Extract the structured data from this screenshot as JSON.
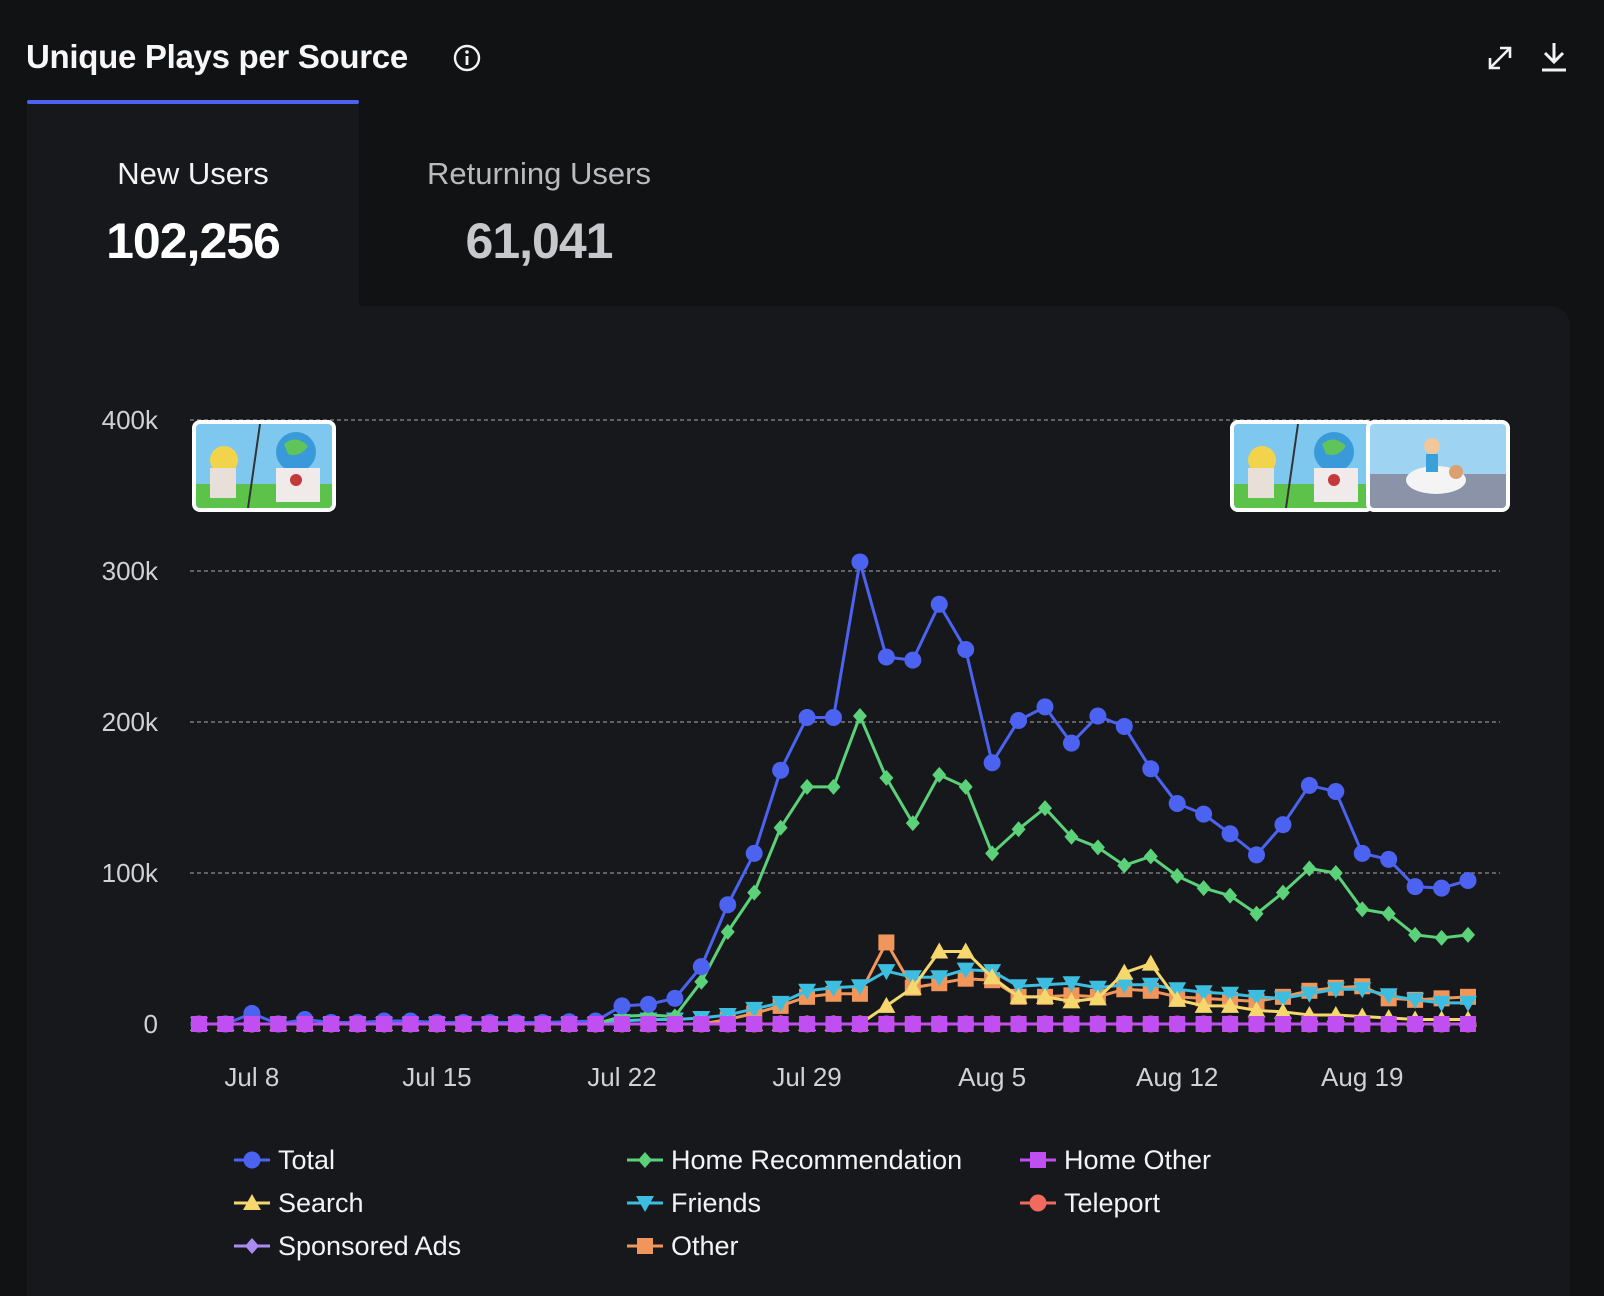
{
  "card": {
    "title": "Unique Plays per Source",
    "icons": {
      "info": "info-icon",
      "expand": "expand-icon",
      "download": "download-icon"
    }
  },
  "tabs": [
    {
      "label": "New Users",
      "value": "102,256",
      "active": true
    },
    {
      "label": "Returning Users",
      "value": "61,041",
      "active": false
    }
  ],
  "colors": {
    "accent": "#4b63f0",
    "background": "#111214",
    "panel": "#17181b"
  },
  "chart_data": {
    "type": "line",
    "ylim": [
      0,
      400000
    ],
    "yticks": [
      0,
      100000,
      200000,
      300000,
      400000
    ],
    "ytick_labels": [
      "0",
      "100k",
      "200k",
      "300k",
      "400k"
    ],
    "xlim": [
      "2024-07-06",
      "2024-08-23"
    ],
    "xticks": [
      "2024-07-08",
      "2024-07-15",
      "2024-07-22",
      "2024-07-29",
      "2024-08-05",
      "2024-08-12",
      "2024-08-19"
    ],
    "xtick_labels": [
      "Jul 8",
      "Jul 15",
      "Jul 22",
      "Jul 29",
      "Aug 5",
      "Aug 12",
      "Aug 19"
    ],
    "grid": "horizontal dashed",
    "legend_position": "bottom",
    "x": [
      "2024-07-06",
      "2024-07-07",
      "2024-07-08",
      "2024-07-09",
      "2024-07-10",
      "2024-07-11",
      "2024-07-12",
      "2024-07-13",
      "2024-07-14",
      "2024-07-15",
      "2024-07-16",
      "2024-07-17",
      "2024-07-18",
      "2024-07-19",
      "2024-07-20",
      "2024-07-21",
      "2024-07-22",
      "2024-07-23",
      "2024-07-24",
      "2024-07-25",
      "2024-07-26",
      "2024-07-27",
      "2024-07-28",
      "2024-07-29",
      "2024-07-30",
      "2024-07-31",
      "2024-08-01",
      "2024-08-02",
      "2024-08-03",
      "2024-08-04",
      "2024-08-05",
      "2024-08-06",
      "2024-08-07",
      "2024-08-08",
      "2024-08-09",
      "2024-08-10",
      "2024-08-11",
      "2024-08-12",
      "2024-08-13",
      "2024-08-14",
      "2024-08-15",
      "2024-08-16",
      "2024-08-17",
      "2024-08-18",
      "2024-08-19",
      "2024-08-20",
      "2024-08-21",
      "2024-08-22",
      "2024-08-23"
    ],
    "series": [
      {
        "name": "Total",
        "color": "#4b63f0",
        "marker": "circle",
        "values": [
          0,
          0,
          7000,
          0,
          3000,
          1000,
          1000,
          2000,
          2000,
          1000,
          1000,
          1000,
          1000,
          1000,
          1500,
          2000,
          12000,
          13000,
          17000,
          38000,
          79000,
          113000,
          168000,
          203000,
          203000,
          306000,
          243000,
          241000,
          278000,
          248000,
          173000,
          201000,
          210000,
          186000,
          204000,
          197000,
          169000,
          146000,
          139000,
          126000,
          112000,
          132000,
          158000,
          154000,
          113000,
          109000,
          91000,
          90000,
          95000
        ]
      },
      {
        "name": "Home Recommendation",
        "color": "#5bd17a",
        "marker": "diamond",
        "values": [
          0,
          0,
          0,
          0,
          0,
          0,
          0,
          0,
          0,
          0,
          0,
          0,
          0,
          0,
          0,
          0,
          5000,
          6000,
          5000,
          28000,
          61000,
          87000,
          130000,
          157000,
          157000,
          204000,
          163000,
          133000,
          165000,
          157000,
          113000,
          129000,
          143000,
          124000,
          117000,
          105000,
          111000,
          98000,
          90000,
          85000,
          73000,
          87000,
          103000,
          100000,
          76000,
          73000,
          59000,
          57000,
          59000
        ]
      },
      {
        "name": "Home Other",
        "color": "#c04ef0",
        "marker": "square",
        "values": [
          0,
          0,
          0,
          0,
          0,
          0,
          0,
          0,
          0,
          0,
          0,
          0,
          0,
          0,
          0,
          0,
          0,
          0,
          0,
          0,
          0,
          0,
          0,
          0,
          0,
          0,
          0,
          0,
          0,
          0,
          0,
          0,
          0,
          0,
          0,
          0,
          0,
          0,
          0,
          0,
          0,
          0,
          0,
          0,
          0,
          0,
          0,
          0,
          0
        ]
      },
      {
        "name": "Search",
        "color": "#f5d76e",
        "marker": "triangle-up",
        "values": [
          0,
          0,
          0,
          0,
          0,
          0,
          0,
          0,
          0,
          0,
          0,
          0,
          0,
          0,
          0,
          0,
          0,
          0,
          0,
          0,
          0,
          0,
          0,
          0,
          0,
          0,
          12000,
          24000,
          48000,
          48000,
          31000,
          18000,
          18000,
          15000,
          17000,
          34000,
          40000,
          16000,
          12000,
          12000,
          9000,
          8000,
          6000,
          6000,
          5000,
          4000,
          3000,
          3000,
          3000
        ]
      },
      {
        "name": "Friends",
        "color": "#3dbde0",
        "marker": "triangle-down",
        "values": [
          0,
          0,
          0,
          0,
          0,
          0,
          0,
          0,
          0,
          0,
          0,
          0,
          0,
          0,
          0,
          0,
          2000,
          3000,
          3000,
          4000,
          6000,
          10000,
          14000,
          22000,
          24000,
          25000,
          35000,
          31000,
          31000,
          36000,
          35000,
          25000,
          26000,
          27000,
          24000,
          26000,
          26000,
          23000,
          21000,
          20000,
          18000,
          17000,
          20000,
          23000,
          23000,
          19000,
          16000,
          14000,
          14000
        ]
      },
      {
        "name": "Teleport",
        "color": "#f06a5e",
        "marker": "circle",
        "values": [
          0,
          0,
          0,
          0,
          0,
          0,
          0,
          0,
          0,
          0,
          0,
          0,
          0,
          0,
          0,
          0,
          0,
          0,
          0,
          0,
          0,
          0,
          0,
          0,
          0,
          0,
          0,
          0,
          0,
          0,
          0,
          0,
          0,
          0,
          0,
          0,
          0,
          0,
          0,
          0,
          0,
          0,
          0,
          0,
          0,
          0,
          0,
          0,
          0
        ]
      },
      {
        "name": "Sponsored Ads",
        "color": "#a98bf2",
        "marker": "diamond",
        "values": [
          0,
          0,
          0,
          0,
          0,
          0,
          0,
          0,
          0,
          0,
          0,
          0,
          0,
          0,
          0,
          0,
          0,
          0,
          0,
          0,
          0,
          0,
          0,
          0,
          0,
          0,
          0,
          0,
          0,
          0,
          0,
          0,
          0,
          0,
          0,
          0,
          0,
          0,
          0,
          0,
          0,
          0,
          0,
          0,
          0,
          0,
          0,
          0,
          0
        ]
      },
      {
        "name": "Other",
        "color": "#f0965a",
        "marker": "square",
        "values": [
          0,
          0,
          0,
          0,
          0,
          0,
          0,
          0,
          0,
          0,
          0,
          0,
          0,
          0,
          0,
          0,
          0,
          0,
          0,
          0,
          3000,
          7000,
          12000,
          18000,
          20000,
          20000,
          54000,
          24000,
          27000,
          30000,
          29000,
          18000,
          18000,
          19000,
          18000,
          23000,
          22000,
          18000,
          17000,
          16000,
          15000,
          18000,
          22000,
          24000,
          25000,
          17000,
          16000,
          17000,
          18000
        ]
      }
    ],
    "annotations": [
      {
        "date": "2024-07-06",
        "kind": "thumbnail-update-icon"
      },
      {
        "date": "2024-08-23",
        "kind": "thumbnail-update-icon"
      },
      {
        "date": "2024-08-23",
        "kind": "thumbnail-update-icon"
      }
    ]
  }
}
